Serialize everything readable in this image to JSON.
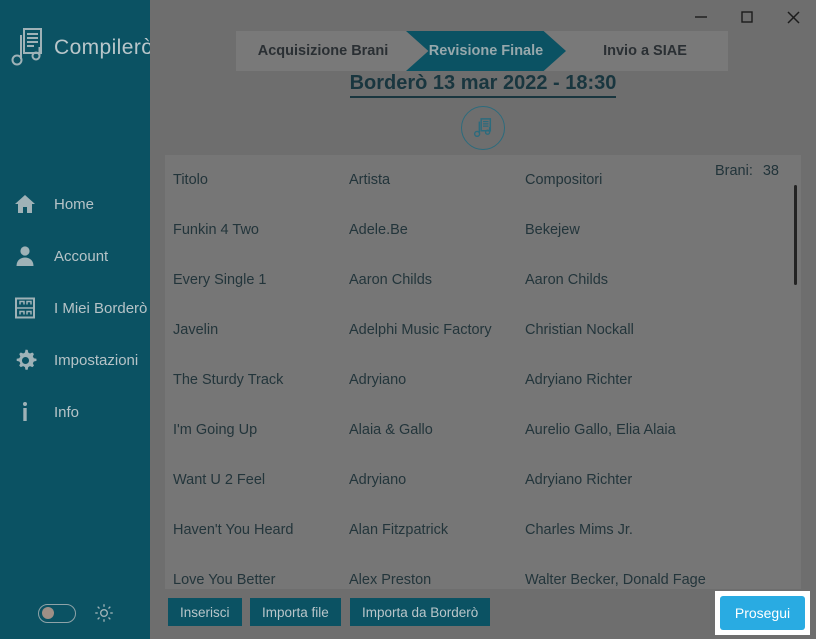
{
  "app": {
    "brand": "Compilerò",
    "brand_icon": "music-sheet-icon"
  },
  "window_controls": [
    {
      "name": "minimize",
      "glyph": "minimize-icon"
    },
    {
      "name": "maximize",
      "glyph": "maximize-icon"
    },
    {
      "name": "close",
      "glyph": "close-icon"
    }
  ],
  "sidebar": {
    "items": [
      {
        "label": "Home",
        "icon": "home-icon"
      },
      {
        "label": "Account",
        "icon": "person-icon"
      },
      {
        "label": "I Miei Borderò",
        "icon": "music-sheet-icon"
      },
      {
        "label": "Impostazioni",
        "icon": "gear-icon"
      },
      {
        "label": "Info",
        "icon": "info-icon"
      }
    ],
    "theme_toggle": {
      "name": "theme-toggle",
      "state": "off"
    },
    "brightness_icon": "sun-icon"
  },
  "steps": [
    {
      "label": "Acquisizione Brani",
      "active": false
    },
    {
      "label": "Revisione Finale",
      "active": true
    },
    {
      "label": "Invio a SIAE",
      "active": false
    }
  ],
  "header": {
    "bordero_title": "Borderò 13 mar 2022 - 18:30",
    "badge_icon": "music-note-badge-icon"
  },
  "table": {
    "columns": [
      "Titolo",
      "Artista",
      "Compositori"
    ],
    "count_label": "Brani:",
    "count_value": "38",
    "rows": [
      {
        "titolo": "Funkin 4 Two",
        "artista": "Adele.Be",
        "compositori": "Bekejew"
      },
      {
        "titolo": "Every Single 1",
        "artista": "Aaron Childs",
        "compositori": "Aaron Childs"
      },
      {
        "titolo": "Javelin",
        "artista": "Adelphi Music Factory",
        "compositori": "Christian Nockall"
      },
      {
        "titolo": "The Sturdy Track",
        "artista": "Adryiano",
        "compositori": "Adryiano Richter"
      },
      {
        "titolo": "I'm Going Up",
        "artista": "Alaia & Gallo",
        "compositori": "Aurelio Gallo, Elia Alaia"
      },
      {
        "titolo": "Want U 2 Feel",
        "artista": "Adryiano",
        "compositori": "Adryiano Richter"
      },
      {
        "titolo": "Haven't You Heard",
        "artista": "Alan Fitzpatrick",
        "compositori": "Charles Mims Jr."
      },
      {
        "titolo": "Love You Better",
        "artista": "Alex Preston",
        "compositori": "Walter Becker, Donald Fage"
      }
    ]
  },
  "buttons": {
    "inserisci": "Inserisci",
    "importa_file": "Importa file",
    "importa_da_bordero": "Importa da Borderò",
    "prosegui": "Prosegui"
  },
  "colors": {
    "sidebar": "#0b5263",
    "background": "#6e6e6e",
    "panel": "#767676",
    "accent": "#29abe2",
    "title_text": "#19363f"
  }
}
